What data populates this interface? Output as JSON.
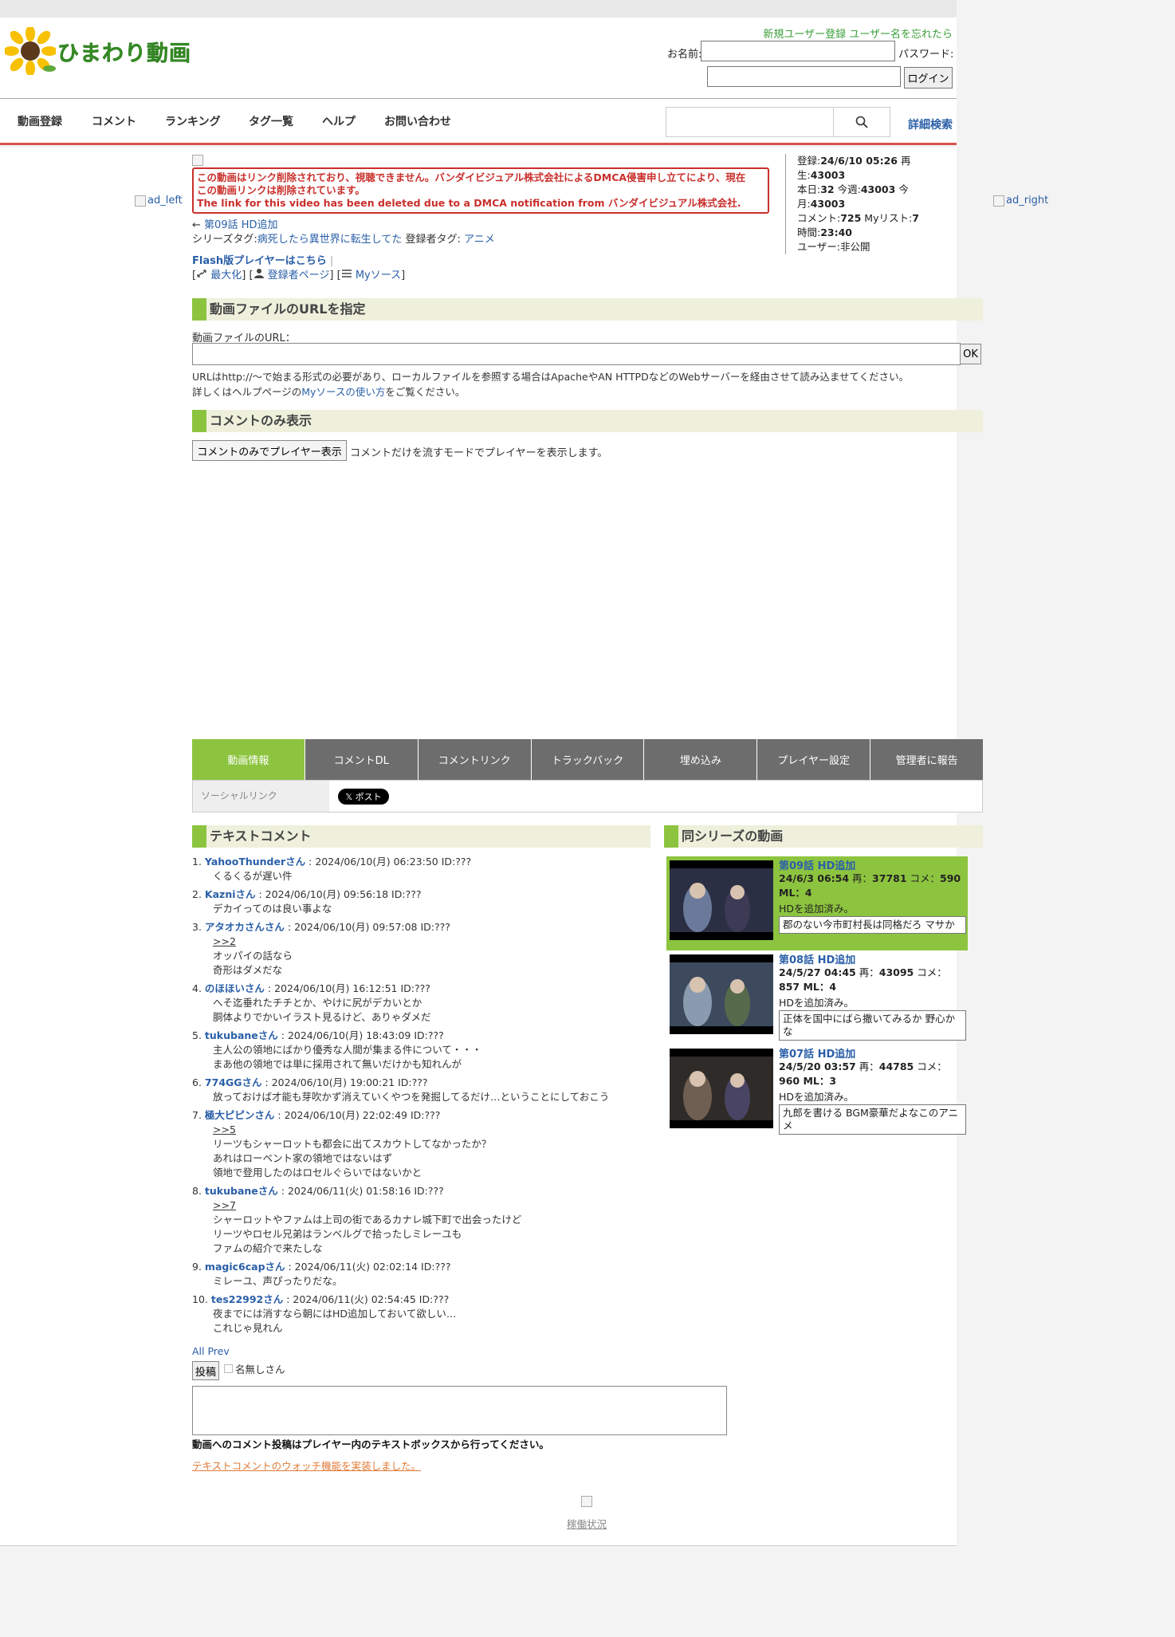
{
  "header": {
    "logo_text": "ひまわり動画",
    "register_link": "新規ユーザー登録",
    "forgot_link": "ユーザー名を忘れたら",
    "name_label": "お名前:",
    "password_label": "パスワード:",
    "login_button": "ログイン"
  },
  "nav": {
    "items": [
      "動画登録",
      "コメント",
      "ランキング",
      "タグ一覧",
      "ヘルプ",
      "お問い合わせ"
    ],
    "advanced_search": "詳細検索"
  },
  "ads": {
    "left": "ad_left",
    "right": "ad_right"
  },
  "notice": {
    "line1": "この動画はリンク削除されており、視聴できません。バンダイビジュアル株式会社によるDMCA侵害申し立てにより、現在",
    "line2": "この動画リンクは削除されています。",
    "line3": "The link for this video has been deleted due to a DMCA notification from バンダイビジュアル株式会社."
  },
  "stats": {
    "registered_label": "登録:",
    "registered": "24/6/10 05:26",
    "plays_label": "再生:",
    "plays": "43003",
    "today_label": "本日:",
    "today": "32",
    "week_label": "今週:",
    "week": "43003",
    "month_label": "今月:",
    "month": "43003",
    "comments_label": "コメント:",
    "comments": "725",
    "mylist_label": "Myリスト:",
    "mylist": "7",
    "time_label": "時間:",
    "time": "23:40",
    "user_label": "ユーザー:",
    "user": "非公開"
  },
  "video_info": {
    "prev_arrow": "←",
    "prev_link": "第09話 HD追加",
    "series_tag_label": "シリーズタグ:",
    "series_tag": "病死したら異世界に転生してた",
    "registrant_tag_label": "登録者タグ:",
    "registrant_tag": "アニメ",
    "flash_link": "Flash版プレイヤーはこちら",
    "flash_sep": "|",
    "maximize": "最大化",
    "registrant_page": "登録者ページ",
    "my_source": "Myソース"
  },
  "url_section": {
    "header": "動画ファイルのURLを指定",
    "label": "動画ファイルのURL：",
    "ok_button": "OK",
    "note1": "URLはhttp://～で始まる形式の必要があり、ローカルファイルを参照する場合はApacheやAN HTTPDなどのWebサーバーを経由させて読み込ませてください。",
    "note2_pre": "詳しくはヘルプページの",
    "note2_link": "Myソースの使い方",
    "note2_post": "をご覧ください。"
  },
  "comment_only": {
    "header": "コメントのみ表示",
    "button": "コメントのみでプレイヤー表示",
    "note": "コメントだけを流すモードでプレイヤーを表示します。"
  },
  "tabs": [
    "動画情報",
    "コメントDL",
    "コメントリンク",
    "トラックバック",
    "埋め込み",
    "プレイヤー設定",
    "管理者に報告"
  ],
  "social": {
    "label": "ソーシャルリンク",
    "x_button": "𝕏 ポスト"
  },
  "text_comments": {
    "header": "テキストコメント",
    "items": [
      {
        "num": "1.",
        "name": "YahooThunderさん",
        "meta": " : 2024/06/10(月) 06:23:50 ID:???",
        "anchor": "",
        "lines": [
          "くるくるが遅い件"
        ]
      },
      {
        "num": "2.",
        "name": "Kazniさん",
        "meta": " : 2024/06/10(月) 09:56:18 ID:???",
        "anchor": "",
        "lines": [
          "デカイってのは良い事よな"
        ]
      },
      {
        "num": "3.",
        "name": "アタオカさんさん",
        "meta": " : 2024/06/10(月) 09:57:08 ID:???",
        "anchor": ">>2",
        "lines": [
          "オッパイの話なら",
          "奇形はダメだな"
        ]
      },
      {
        "num": "4.",
        "name": "のほほいさん",
        "meta": " : 2024/06/10(月) 16:12:51 ID:???",
        "anchor": "",
        "lines": [
          "へそ迄垂れたチチとか、やけに尻がデカいとか",
          "胴体よりでかいイラスト見るけど、ありゃダメだ"
        ]
      },
      {
        "num": "5.",
        "name": "tukubaneさん",
        "meta": " : 2024/06/10(月) 18:43:09 ID:???",
        "anchor": "",
        "lines": [
          "主人公の領地にばかり優秀な人間が集まる件について・・・",
          "まあ他の領地では単に採用されて無いだけかも知れんが"
        ]
      },
      {
        "num": "6.",
        "name": "774GGさん",
        "meta": " : 2024/06/10(月) 19:00:21 ID:???",
        "anchor": "",
        "lines": [
          "放っておけば才能も芽吹かず消えていくやつを発掘してるだけ…ということにしておこう"
        ]
      },
      {
        "num": "7.",
        "name": "極大ピピンさん",
        "meta": " : 2024/06/10(月) 22:02:49 ID:???",
        "anchor": ">>5",
        "lines": [
          "リーツもシャーロットも都会に出てスカウトしてなかったか？",
          "あれはローベント家の領地ではないはず",
          "領地で登用したのはロセルぐらいではないかと"
        ]
      },
      {
        "num": "8.",
        "name": "tukubaneさん",
        "meta": " : 2024/06/11(火) 01:58:16 ID:???",
        "anchor": ">>7",
        "lines": [
          "シャーロットやファムは上司の街であるカナレ城下町で出会ったけど",
          "リーツやロセル兄弟はランベルグで拾ったしミレーユも",
          "ファムの紹介で来たしな"
        ]
      },
      {
        "num": "9.",
        "name": "magic6capさん",
        "meta": " : 2024/06/11(火) 02:02:14 ID:???",
        "anchor": "",
        "lines": [
          "ミレーユ、声ぴったりだな。"
        ]
      },
      {
        "num": "10.",
        "name": "tes22992さん",
        "meta": " : 2024/06/11(火) 02:54:45 ID:???",
        "anchor": "",
        "lines": [
          "夜までには消すなら朝にはHD追加しておいて欲しい…",
          "これじゃ見れん"
        ]
      }
    ],
    "pager": "All Prev",
    "post_button": "投稿",
    "anon_label": "名無しさん",
    "post_note": "動画へのコメント投稿はプレイヤー内のテキストボックスから行ってください。",
    "watch_link": "テキストコメントのウォッチ機能を実装しました。"
  },
  "related": {
    "header": "同シリーズの動画",
    "items": [
      {
        "title": "第09話 HD追加",
        "date": "24/6/3 06:54",
        "plays_label": " 再：",
        "plays": "37781",
        "comments_label": " コメ：",
        "comments": "590",
        "mylist": " ML：4",
        "desc": "HDを追加済み。",
        "top_comment": "郡のない今市町村長は同格だろ マサか"
      },
      {
        "title": "第08話 HD追加",
        "date": "24/5/27 04:45",
        "plays_label": " 再：",
        "plays": "43095",
        "comments_label": " コメ：",
        "comments": "857",
        "mylist": " ML：4",
        "desc": "HDを追加済み。",
        "top_comment": "正体を国中にばら撒いてみるか 野心かな"
      },
      {
        "title": "第07話 HD追加",
        "date": "24/5/20 03:57",
        "plays_label": " 再：",
        "plays": "44785",
        "comments_label": " コメ：",
        "comments": "960",
        "mylist": " ML：3",
        "desc": "HDを追加済み。",
        "top_comment": "九郎を書ける BGM豪華だよなこのアニメ"
      }
    ]
  },
  "footer": {
    "status_link": "稼働状況"
  }
}
